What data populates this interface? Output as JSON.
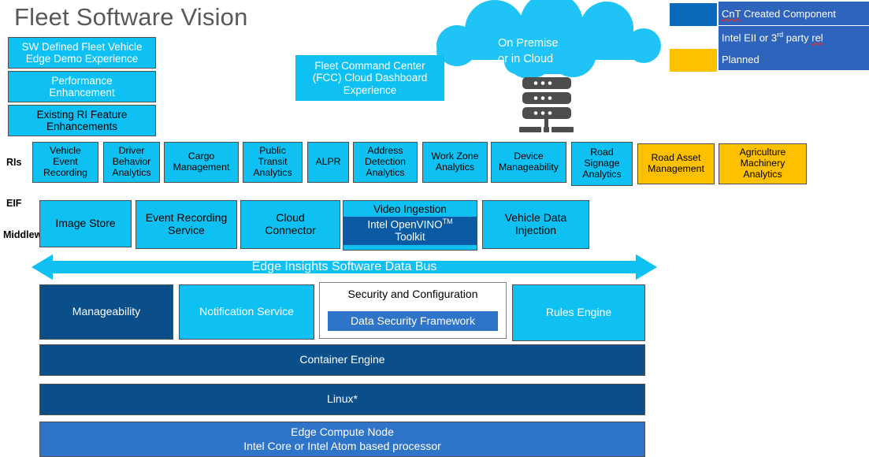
{
  "page": {
    "title": "Fleet Software Vision"
  },
  "colors": {
    "cyan": "#0fc1f3",
    "amber": "#ffc000",
    "navy": "#0a4f8a",
    "mid_blue": "#2e74c8",
    "legend_label_blue": "#2e64bb",
    "openvino_blue": "#0a5ba3",
    "title_gray": "#595959"
  },
  "legend": {
    "items": [
      {
        "swatch_color": "#0969ba",
        "label": "CnT Created Component",
        "squiggle": "CnT",
        "rest": " Created Component"
      },
      {
        "swatch_color": "#ffffff",
        "label": "Intel EII or 3rd party rel",
        "prefix": "Intel EII or 3",
        "sup": "rd",
        "mid": " party ",
        "squiggle2": "rel"
      },
      {
        "swatch_color": "#ffc000",
        "label": "Planned"
      }
    ]
  },
  "left_cards": [
    {
      "label": "SW Defined Fleet Vehicle Edge Demo Experience",
      "line1": "SW Defined Fleet Vehicle",
      "line2": "Edge Demo Experience",
      "text_color": "#ffffff",
      "fill": "#0fc1f3"
    },
    {
      "label": "Performance Enhancement",
      "line1": "Performance",
      "line2": "Enhancement",
      "text_color": "#ffffff",
      "fill": "#0fc1f3"
    },
    {
      "label": "Existing RI Feature Enhancements",
      "line1": "Existing RI Feature",
      "line2": "Enhancements",
      "text_color": "#000000",
      "fill": "#0fc1f3"
    }
  ],
  "fcc": {
    "line1": "Fleet Command Center",
    "line2": "(FCC) Cloud Dashboard",
    "line3": "Experience"
  },
  "cloud": {
    "line1": "On Premise",
    "line2": "or in Cloud"
  },
  "row_labels": {
    "ris": "RIs",
    "eif": "EIF",
    "middleware": "Middleware"
  },
  "ris_row": [
    {
      "lines": [
        "Vehicle",
        "Event",
        "Recording"
      ],
      "status": "cnt",
      "fill": "#0fc1f3"
    },
    {
      "lines": [
        "Driver",
        "Behavior",
        "Analytics"
      ],
      "status": "cnt",
      "fill": "#0fc1f3"
    },
    {
      "lines": [
        "Cargo",
        "Management"
      ],
      "status": "cnt",
      "fill": "#0fc1f3"
    },
    {
      "lines": [
        "Public",
        "Transit",
        "Analytics"
      ],
      "status": "cnt",
      "fill": "#0fc1f3"
    },
    {
      "lines": [
        "ALPR"
      ],
      "status": "cnt",
      "fill": "#0fc1f3"
    },
    {
      "lines": [
        "Address",
        "Detection",
        "Analytics"
      ],
      "status": "cnt",
      "fill": "#0fc1f3"
    },
    {
      "lines": [
        "Work Zone",
        "Analytics"
      ],
      "status": "cnt",
      "fill": "#0fc1f3"
    },
    {
      "lines": [
        "Device",
        "Manageability"
      ],
      "status": "cnt",
      "fill": "#0fc1f3"
    },
    {
      "lines": [
        "Road",
        "Signage",
        "Analytics"
      ],
      "status": "cnt",
      "fill": "#0fc1f3"
    },
    {
      "lines": [
        "Road Asset",
        "Management"
      ],
      "status": "planned",
      "fill": "#ffc000"
    },
    {
      "lines": [
        "Agriculture",
        "Machinery",
        "Analytics"
      ],
      "status": "planned",
      "fill": "#ffc000"
    }
  ],
  "eif_row": [
    {
      "label": "Image Store",
      "fill": "#0fc1f3"
    },
    {
      "lines": [
        "Event Recording",
        "Service"
      ],
      "fill": "#0fc1f3"
    },
    {
      "lines": [
        "Cloud",
        "Connector"
      ],
      "fill": "#0fc1f3"
    },
    {
      "title": "Video Ingestion",
      "inner_line1": "Intel OpenVINO",
      "inner_sup": "TM",
      "inner_line2": "Toolkit",
      "fill": "#0fc1f3",
      "inner_fill": "#0a5ba3"
    },
    {
      "lines": [
        "Vehicle Data",
        "Injection"
      ],
      "fill": "#0fc1f3"
    }
  ],
  "data_bus": {
    "label": "Edge Insights Software Data Bus",
    "fill": "#0fc1f3"
  },
  "services_row": [
    {
      "label": "Manageability",
      "fill": "#0a4f8a",
      "text_color": "#ffffff"
    },
    {
      "label": "Notification Service",
      "fill": "#0fc1f3",
      "text_color": "#ffffff"
    },
    {
      "title": "Security and Configuration",
      "inner_label": "Data Security Framework",
      "fill": "#ffffff",
      "inner_fill": "#2e74c8"
    },
    {
      "label": "Rules Engine",
      "fill": "#0fc1f3",
      "text_color": "#ffffff"
    }
  ],
  "stack_rows": [
    {
      "label": "Container Engine",
      "fill": "#0a4f8a"
    },
    {
      "label": "Linux*",
      "fill": "#0a4f8a"
    },
    {
      "line1": "Edge Compute Node",
      "line2": "Intel Core or Intel Atom based processor",
      "fill": "#2e74c8"
    }
  ]
}
